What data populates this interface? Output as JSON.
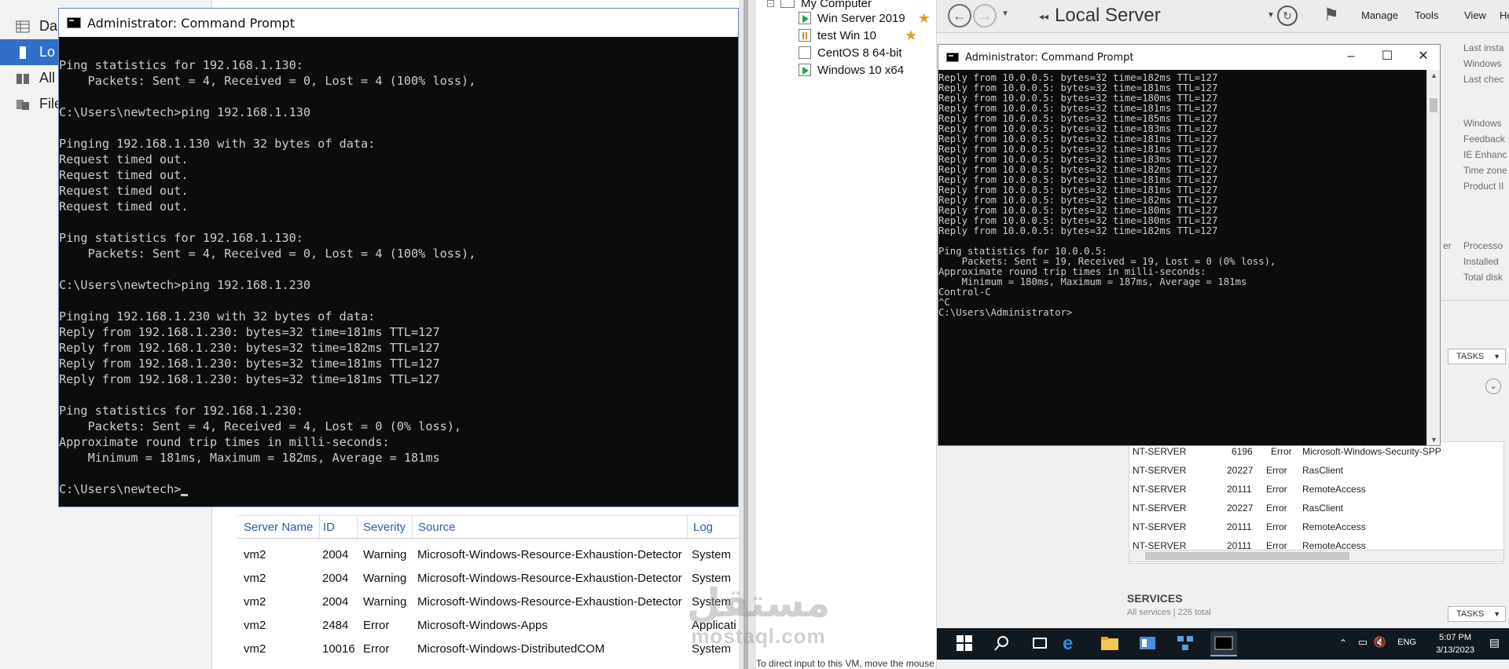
{
  "left_server_manager": {
    "nav": [
      "Da",
      "Lo",
      "All",
      "File"
    ],
    "events_table": {
      "headers": [
        "Server Name",
        "ID",
        "Severity",
        "Source",
        "Log"
      ],
      "rows": [
        [
          "vm2",
          "2004",
          "Warning",
          "Microsoft-Windows-Resource-Exhaustion-Detector",
          "System"
        ],
        [
          "vm2",
          "2004",
          "Warning",
          "Microsoft-Windows-Resource-Exhaustion-Detector",
          "System"
        ],
        [
          "vm2",
          "2004",
          "Warning",
          "Microsoft-Windows-Resource-Exhaustion-Detector",
          "System"
        ],
        [
          "vm2",
          "2484",
          "Error",
          "Microsoft-Windows-Apps",
          "Applicati"
        ],
        [
          "vm2",
          "10016",
          "Error",
          "Microsoft-Windows-DistributedCOM",
          "System"
        ]
      ]
    }
  },
  "cmd_left": {
    "title": "Administrator: Command Prompt",
    "lines": [
      "Ping statistics for 192.168.1.130:",
      "    Packets: Sent = 4, Received = 0, Lost = 4 (100% loss),",
      "",
      "C:\\Users\\newtech>ping 192.168.1.130",
      "",
      "Pinging 192.168.1.130 with 32 bytes of data:",
      "Request timed out.",
      "Request timed out.",
      "Request timed out.",
      "Request timed out.",
      "",
      "Ping statistics for 192.168.1.130:",
      "    Packets: Sent = 4, Received = 0, Lost = 4 (100% loss),",
      "",
      "C:\\Users\\newtech>ping 192.168.1.230",
      "",
      "Pinging 192.168.1.230 with 32 bytes of data:",
      "Reply from 192.168.1.230: bytes=32 time=181ms TTL=127",
      "Reply from 192.168.1.230: bytes=32 time=182ms TTL=127",
      "Reply from 192.168.1.230: bytes=32 time=181ms TTL=127",
      "Reply from 192.168.1.230: bytes=32 time=181ms TTL=127",
      "",
      "Ping statistics for 192.168.1.230:",
      "    Packets: Sent = 4, Received = 4, Lost = 0 (0% loss),",
      "Approximate round trip times in milli-seconds:",
      "    Minimum = 181ms, Maximum = 182ms, Average = 181ms",
      ""
    ],
    "prompt": "C:\\Users\\newtech>"
  },
  "vmware": {
    "root": "My Computer",
    "vms": [
      {
        "name": "Win Server 2019",
        "state": "running",
        "favorite": true
      },
      {
        "name": "test Win 10",
        "state": "paused",
        "favorite": true
      },
      {
        "name": "CentOS 8 64-bit",
        "state": "off",
        "favorite": false
      },
      {
        "name": "Windows 10 x64",
        "state": "running",
        "favorite": false
      }
    ],
    "status_hint": "To direct input to this VM, move the mouse pointer inside or press Ctrl+G."
  },
  "guest": {
    "title": "Local Server",
    "menu": [
      "Manage",
      "Tools",
      "View",
      "He"
    ],
    "right_props": [
      "Last insta",
      "Windows",
      "Last chec",
      "Windows",
      "Feedback",
      "IE Enhanc",
      "Time zone",
      "Product II",
      "Processo",
      "Installed",
      "Total disk"
    ],
    "er_fragment": "er",
    "tasks_label": "TASKS",
    "events": [
      [
        "NT-SERVER",
        "6196",
        "Error",
        "Microsoft-Windows-Security-SPP"
      ],
      [
        "NT-SERVER",
        "20227",
        "Error",
        "RasClient"
      ],
      [
        "NT-SERVER",
        "20111",
        "Error",
        "RemoteAccess"
      ],
      [
        "NT-SERVER",
        "20227",
        "Error",
        "RasClient"
      ],
      [
        "NT-SERVER",
        "20111",
        "Error",
        "RemoteAccess"
      ],
      [
        "NT-SERVER",
        "20111",
        "Error",
        "RemoteAccess"
      ]
    ],
    "services_title": "SERVICES",
    "services_sub": "All services | 226 total",
    "taskbar": {
      "lang": "ENG",
      "time": "5:07 PM",
      "date": "3/13/2023"
    }
  },
  "cmd_right": {
    "title": "Administrator: Command Prompt",
    "lines": [
      "Reply from 10.0.0.5: bytes=32 time=182ms TTL=127",
      "Reply from 10.0.0.5: bytes=32 time=181ms TTL=127",
      "Reply from 10.0.0.5: bytes=32 time=180ms TTL=127",
      "Reply from 10.0.0.5: bytes=32 time=181ms TTL=127",
      "Reply from 10.0.0.5: bytes=32 time=185ms TTL=127",
      "Reply from 10.0.0.5: bytes=32 time=183ms TTL=127",
      "Reply from 10.0.0.5: bytes=32 time=181ms TTL=127",
      "Reply from 10.0.0.5: bytes=32 time=181ms TTL=127",
      "Reply from 10.0.0.5: bytes=32 time=183ms TTL=127",
      "Reply from 10.0.0.5: bytes=32 time=182ms TTL=127",
      "Reply from 10.0.0.5: bytes=32 time=181ms TTL=127",
      "Reply from 10.0.0.5: bytes=32 time=181ms TTL=127",
      "Reply from 10.0.0.5: bytes=32 time=182ms TTL=127",
      "Reply from 10.0.0.5: bytes=32 time=180ms TTL=127",
      "Reply from 10.0.0.5: bytes=32 time=180ms TTL=127",
      "Reply from 10.0.0.5: bytes=32 time=182ms TTL=127",
      "",
      "Ping statistics for 10.0.0.5:",
      "    Packets: Sent = 19, Received = 19, Lost = 0 (0% loss),",
      "Approximate round trip times in milli-seconds:",
      "    Minimum = 180ms, Maximum = 187ms, Average = 181ms",
      "Control-C",
      "^C",
      "C:\\Users\\Administrator>"
    ]
  },
  "watermark": {
    "arabic": "مستقل",
    "latin": "mostaql.com"
  }
}
